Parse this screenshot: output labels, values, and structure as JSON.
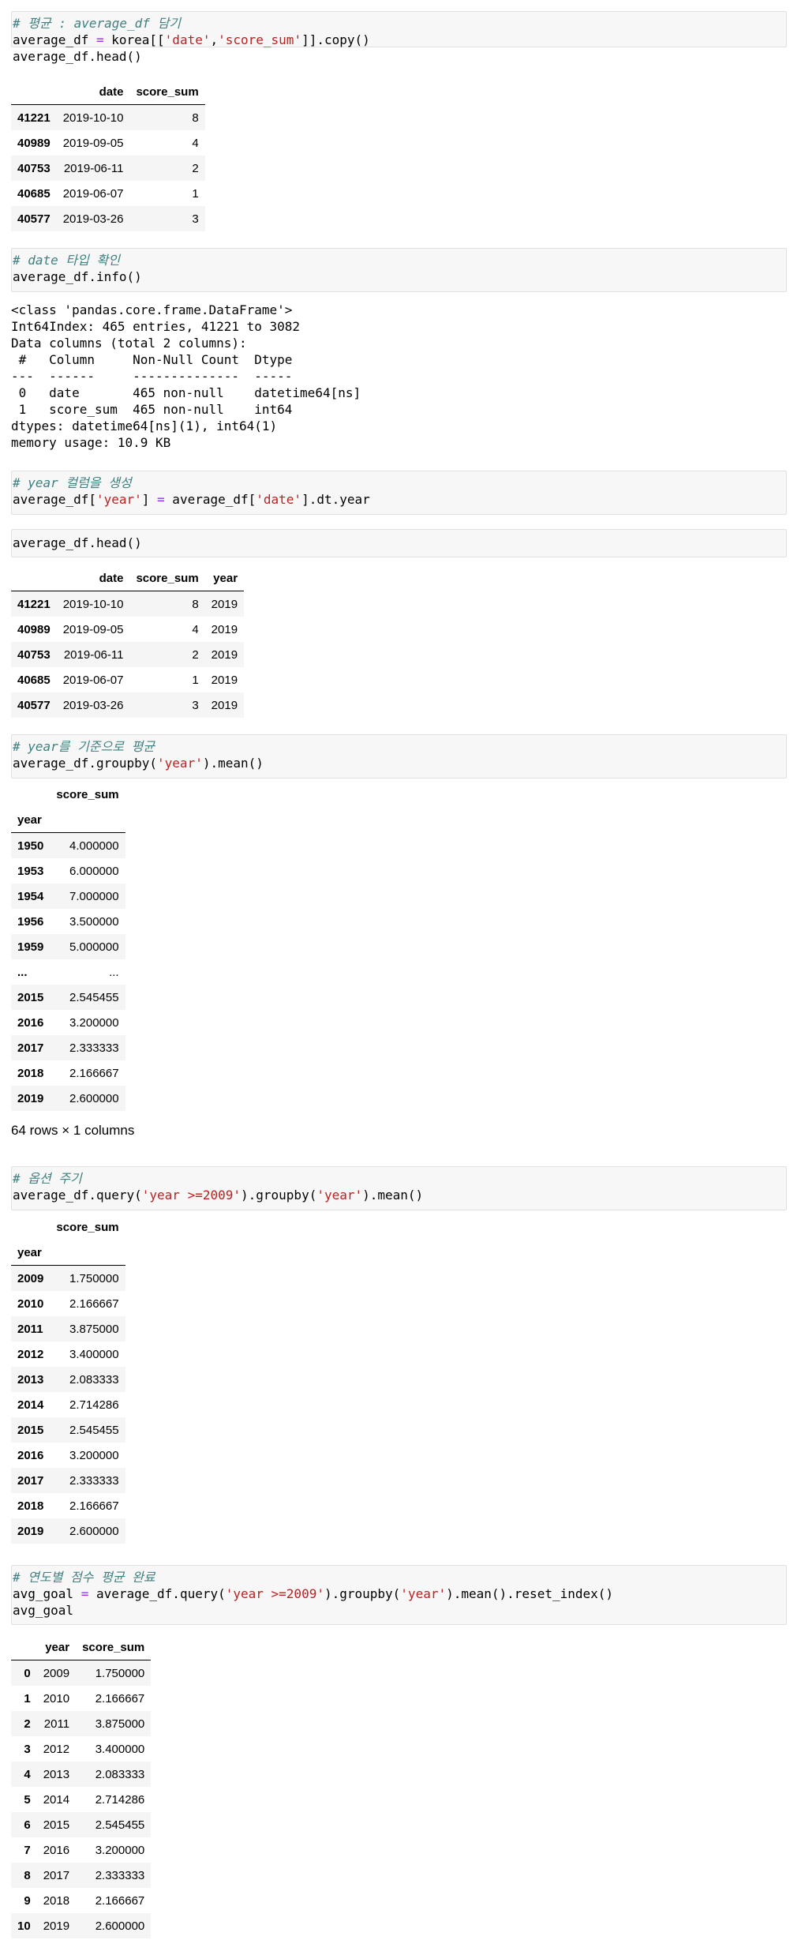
{
  "cells": [
    {
      "code": [
        {
          "parts": [
            {
              "t": "# 평균 : average_df 담기",
              "c": "cm"
            }
          ]
        },
        {
          "parts": [
            {
              "t": "average_df "
            },
            {
              "t": "=",
              "c": "op"
            },
            {
              "t": " korea[["
            },
            {
              "t": "'date'",
              "c": "str"
            },
            {
              "t": ","
            },
            {
              "t": "'score_sum'",
              "c": "str"
            },
            {
              "t": "]].copy()"
            }
          ]
        },
        {
          "parts": [
            {
              "t": "average_df.head()"
            }
          ]
        }
      ],
      "table": {
        "columns": [
          "",
          "date",
          "score_sum"
        ],
        "rows": [
          [
            "41221",
            "2019-10-10",
            "8"
          ],
          [
            "40989",
            "2019-09-05",
            "4"
          ],
          [
            "40753",
            "2019-06-11",
            "2"
          ],
          [
            "40685",
            "2019-06-07",
            "1"
          ],
          [
            "40577",
            "2019-03-26",
            "3"
          ]
        ]
      }
    },
    {
      "code": [
        {
          "parts": [
            {
              "t": "# date 타입 확인",
              "c": "cm"
            }
          ]
        },
        {
          "parts": [
            {
              "t": "average_df.info()"
            }
          ]
        }
      ],
      "text_output": [
        "<class 'pandas.core.frame.DataFrame'>",
        "Int64Index: 465 entries, 41221 to 3082",
        "Data columns (total 2 columns):",
        " #   Column     Non-Null Count  Dtype         ",
        "---  ------     --------------  -----         ",
        " 0   date       465 non-null    datetime64[ns]",
        " 1   score_sum  465 non-null    int64         ",
        "dtypes: datetime64[ns](1), int64(1)",
        "memory usage: 10.9 KB"
      ]
    },
    {
      "code": [
        {
          "parts": [
            {
              "t": "# year 컬럼을 생성",
              "c": "cm"
            }
          ]
        },
        {
          "parts": [
            {
              "t": "average_df["
            },
            {
              "t": "'year'",
              "c": "str"
            },
            {
              "t": "] "
            },
            {
              "t": "=",
              "c": "op"
            },
            {
              "t": " average_df["
            },
            {
              "t": "'date'",
              "c": "str"
            },
            {
              "t": "].dt.year"
            }
          ]
        }
      ]
    },
    {
      "code": [
        {
          "parts": [
            {
              "t": "average_df.head()"
            }
          ]
        }
      ],
      "table": {
        "columns": [
          "",
          "date",
          "score_sum",
          "year"
        ],
        "rows": [
          [
            "41221",
            "2019-10-10",
            "8",
            "2019"
          ],
          [
            "40989",
            "2019-09-05",
            "4",
            "2019"
          ],
          [
            "40753",
            "2019-06-11",
            "2",
            "2019"
          ],
          [
            "40685",
            "2019-06-07",
            "1",
            "2019"
          ],
          [
            "40577",
            "2019-03-26",
            "3",
            "2019"
          ]
        ]
      }
    },
    {
      "code": [
        {
          "parts": [
            {
              "t": "# year를 기준으로 평균",
              "c": "cm"
            }
          ]
        },
        {
          "parts": [
            {
              "t": "average_df.groupby("
            },
            {
              "t": "'year'",
              "c": "str"
            },
            {
              "t": ").mean()"
            }
          ]
        }
      ],
      "table": {
        "columns": [
          "",
          "score_sum"
        ],
        "index_name": "year",
        "rows": [
          [
            "1950",
            "4.000000"
          ],
          [
            "1953",
            "6.000000"
          ],
          [
            "1954",
            "7.000000"
          ],
          [
            "1956",
            "3.500000"
          ],
          [
            "1959",
            "5.000000"
          ],
          [
            "...",
            "..."
          ],
          [
            "2015",
            "2.545455"
          ],
          [
            "2016",
            "3.200000"
          ],
          [
            "2017",
            "2.333333"
          ],
          [
            "2018",
            "2.166667"
          ],
          [
            "2019",
            "2.600000"
          ]
        ],
        "shape_note": "64 rows × 1 columns"
      }
    },
    {
      "code": [
        {
          "parts": [
            {
              "t": "# 옵션 주기",
              "c": "cm"
            }
          ]
        },
        {
          "parts": [
            {
              "t": "average_df.query("
            },
            {
              "t": "'year >=2009'",
              "c": "str"
            },
            {
              "t": ").groupby("
            },
            {
              "t": "'year'",
              "c": "str"
            },
            {
              "t": ").mean()"
            }
          ]
        }
      ],
      "table": {
        "columns": [
          "",
          "score_sum"
        ],
        "index_name": "year",
        "rows": [
          [
            "2009",
            "1.750000"
          ],
          [
            "2010",
            "2.166667"
          ],
          [
            "2011",
            "3.875000"
          ],
          [
            "2012",
            "3.400000"
          ],
          [
            "2013",
            "2.083333"
          ],
          [
            "2014",
            "2.714286"
          ],
          [
            "2015",
            "2.545455"
          ],
          [
            "2016",
            "3.200000"
          ],
          [
            "2017",
            "2.333333"
          ],
          [
            "2018",
            "2.166667"
          ],
          [
            "2019",
            "2.600000"
          ]
        ]
      }
    },
    {
      "code": [
        {
          "parts": [
            {
              "t": "# 연도별 점수 평균 완료",
              "c": "cm"
            }
          ]
        },
        {
          "parts": [
            {
              "t": "avg_goal "
            },
            {
              "t": "=",
              "c": "op"
            },
            {
              "t": " average_df.query("
            },
            {
              "t": "'year >=2009'",
              "c": "str"
            },
            {
              "t": ").groupby("
            },
            {
              "t": "'year'",
              "c": "str"
            },
            {
              "t": ").mean().reset_index()"
            }
          ]
        },
        {
          "parts": [
            {
              "t": "avg_goal"
            }
          ]
        }
      ],
      "table": {
        "columns": [
          "",
          "year",
          "score_sum"
        ],
        "rows": [
          [
            "0",
            "2009",
            "1.750000"
          ],
          [
            "1",
            "2010",
            "2.166667"
          ],
          [
            "2",
            "2011",
            "3.875000"
          ],
          [
            "3",
            "2012",
            "3.400000"
          ],
          [
            "4",
            "2013",
            "2.083333"
          ],
          [
            "5",
            "2014",
            "2.714286"
          ],
          [
            "6",
            "2015",
            "2.545455"
          ],
          [
            "7",
            "2016",
            "3.200000"
          ],
          [
            "8",
            "2017",
            "2.333333"
          ],
          [
            "9",
            "2018",
            "2.166667"
          ],
          [
            "10",
            "2019",
            "2.600000"
          ]
        ]
      }
    }
  ]
}
